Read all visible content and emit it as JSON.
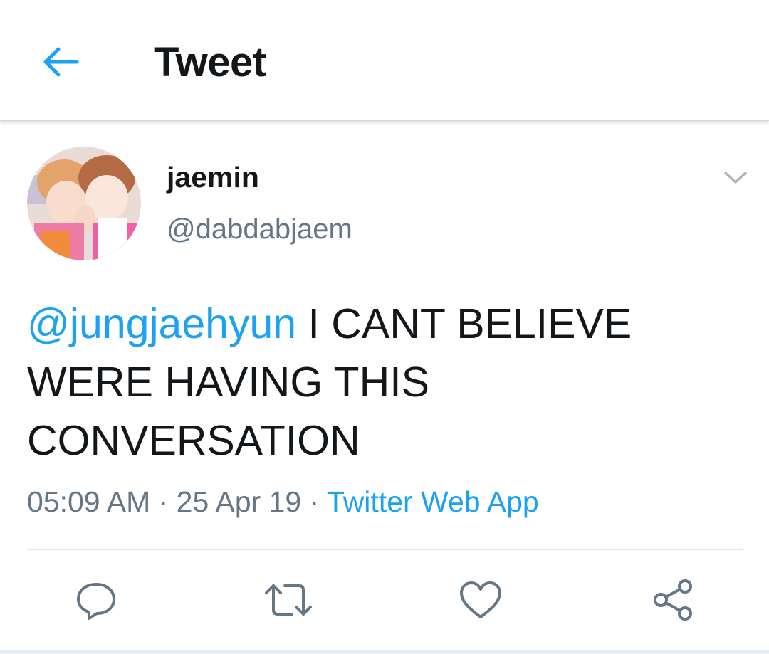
{
  "header": {
    "title": "Tweet",
    "back_icon": "arrow-left-icon"
  },
  "tweet": {
    "author": {
      "display_name": "jaemin",
      "handle": "@dabdabjaem"
    },
    "text": {
      "mention": "@jungjaehyun",
      "body": " I CANT BELIEVE WERE HAVING THIS CONVERSATION"
    },
    "time": "05:09 AM",
    "separator": " · ",
    "date": "25 Apr 19",
    "source": "Twitter Web App"
  },
  "actions": [
    {
      "icon": "reply-icon"
    },
    {
      "icon": "retweet-icon"
    },
    {
      "icon": "like-icon"
    },
    {
      "icon": "share-icon"
    }
  ],
  "colors": {
    "accent": "#1da1f2",
    "text": "#14171a",
    "muted": "#657786",
    "icon": "#657786"
  }
}
